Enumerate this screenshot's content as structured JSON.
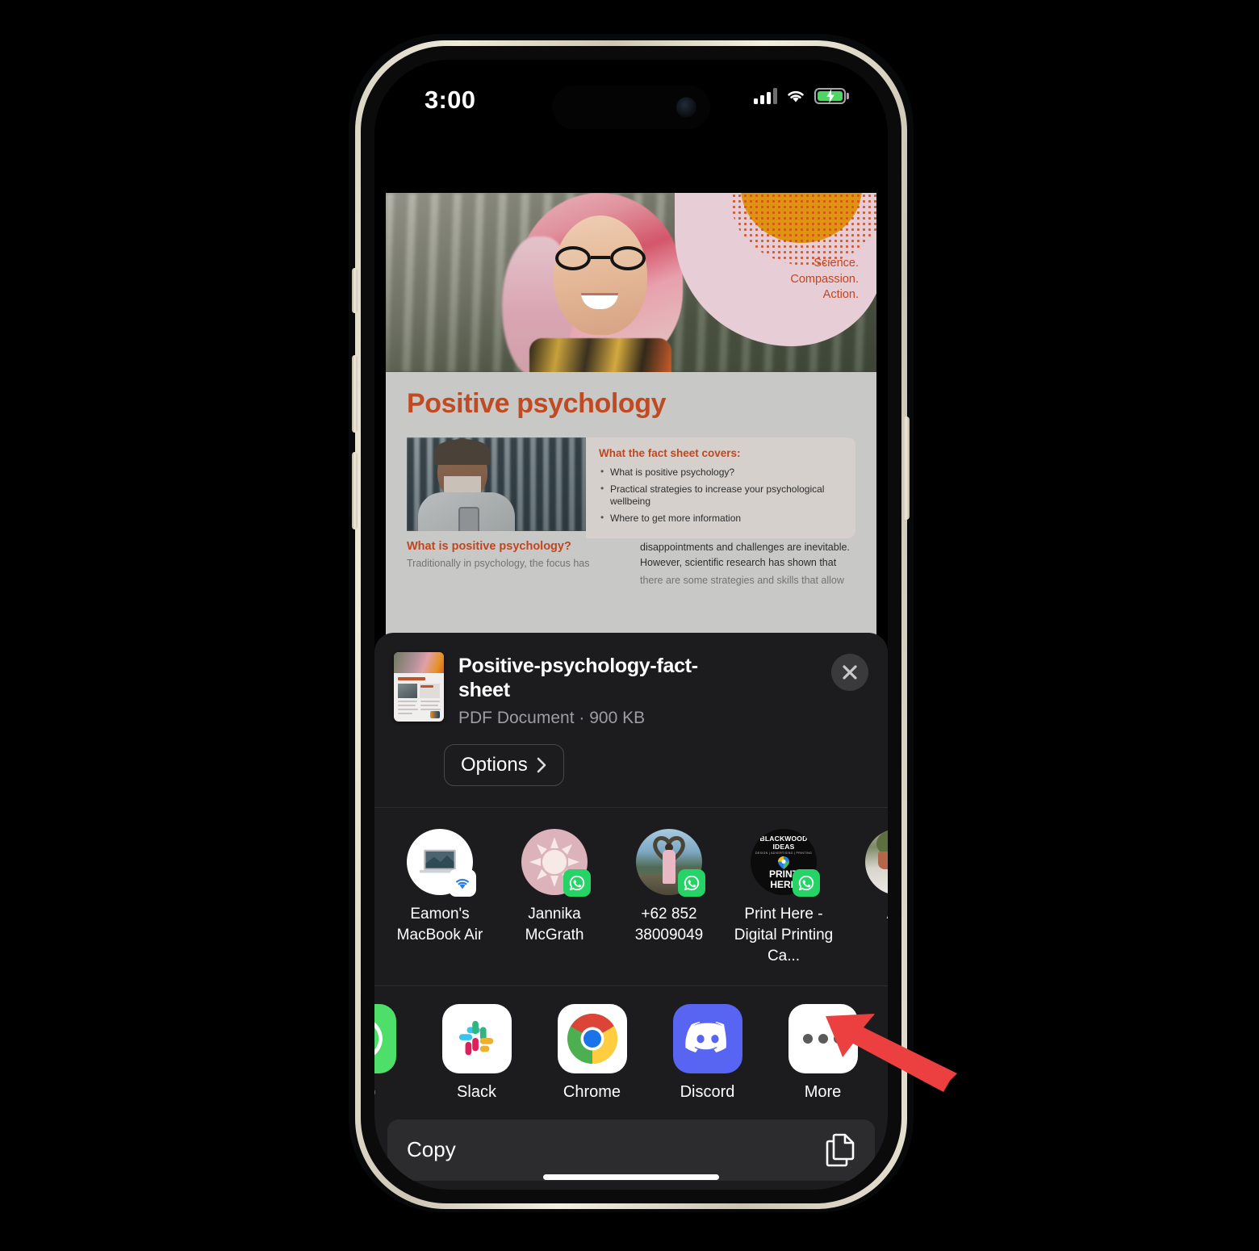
{
  "status_bar": {
    "time": "3:00",
    "signal_icon": "cellular-signal-icon",
    "wifi_icon": "wifi-icon",
    "battery_icon": "battery-charging-icon"
  },
  "pdf_preview": {
    "tagline": "Science.\nCompassion.\nAction.",
    "tagline_lines": [
      "Science.",
      "Compassion.",
      "Action."
    ],
    "title": "Positive psychology",
    "covers_heading": "What the fact sheet covers:",
    "covers_items": [
      "What is positive psychology?",
      "Practical strategies to increase your psychological wellbeing",
      "Where to get more information"
    ],
    "section_heading": "What is positive psychology?",
    "left_column_text": "Traditionally in psychology, the focus has",
    "right_column_text": "disappointments and challenges are inevitable. However, scientific research has shown that",
    "right_column_text_faded": "there are some strategies and skills that allow"
  },
  "share_sheet": {
    "file_name": "Positive-psychology-fact-sheet",
    "file_meta": "PDF Document · 900 KB",
    "options_label": "Options",
    "options_chevron_icon": "chevron-right-icon",
    "close_icon": "close-icon",
    "thumbnail_name": "pdf-thumbnail",
    "contacts": [
      {
        "name": "Eamon's MacBook Air",
        "avatar": "macbook-avatar",
        "badge": "airdrop-badge-icon"
      },
      {
        "name": "Jannika McGrath",
        "avatar": "sun-avatar",
        "badge": "whatsapp-badge-icon"
      },
      {
        "name": "+62 852 38009049",
        "avatar": "beach-photo-avatar",
        "badge": "whatsapp-badge-icon"
      },
      {
        "name": "Print Here - Digital Printing Ca...",
        "avatar": "print-here-avatar",
        "badge": "whatsapp-badge-icon"
      },
      {
        "name": "Arc",
        "avatar": "plant-photo-avatar",
        "badge": ""
      }
    ],
    "print_here_avatar": {
      "brand": "BLACKWOOD IDEAS",
      "subtitle": "DESIGN | ADVERTISING | PRINTING",
      "line1": "PRINT",
      "line2": "HERE"
    },
    "apps": [
      {
        "name": "App",
        "icon": "whatsapp-app-icon"
      },
      {
        "name": "Slack",
        "icon": "slack-app-icon"
      },
      {
        "name": "Chrome",
        "icon": "chrome-app-icon"
      },
      {
        "name": "Discord",
        "icon": "discord-app-icon"
      },
      {
        "name": "More",
        "icon": "more-app-icon"
      }
    ],
    "copy_label": "Copy",
    "copy_icon": "copy-documents-icon"
  },
  "annotation": {
    "arrow_color": "#ec4040",
    "arrow_points_to": "More"
  },
  "colors": {
    "sheet_background": "#1c1c1e",
    "accent_orange": "#c04a22",
    "whatsapp_green": "#25d366",
    "discord_blurple": "#5865f2",
    "battery_green": "#4cd663"
  }
}
